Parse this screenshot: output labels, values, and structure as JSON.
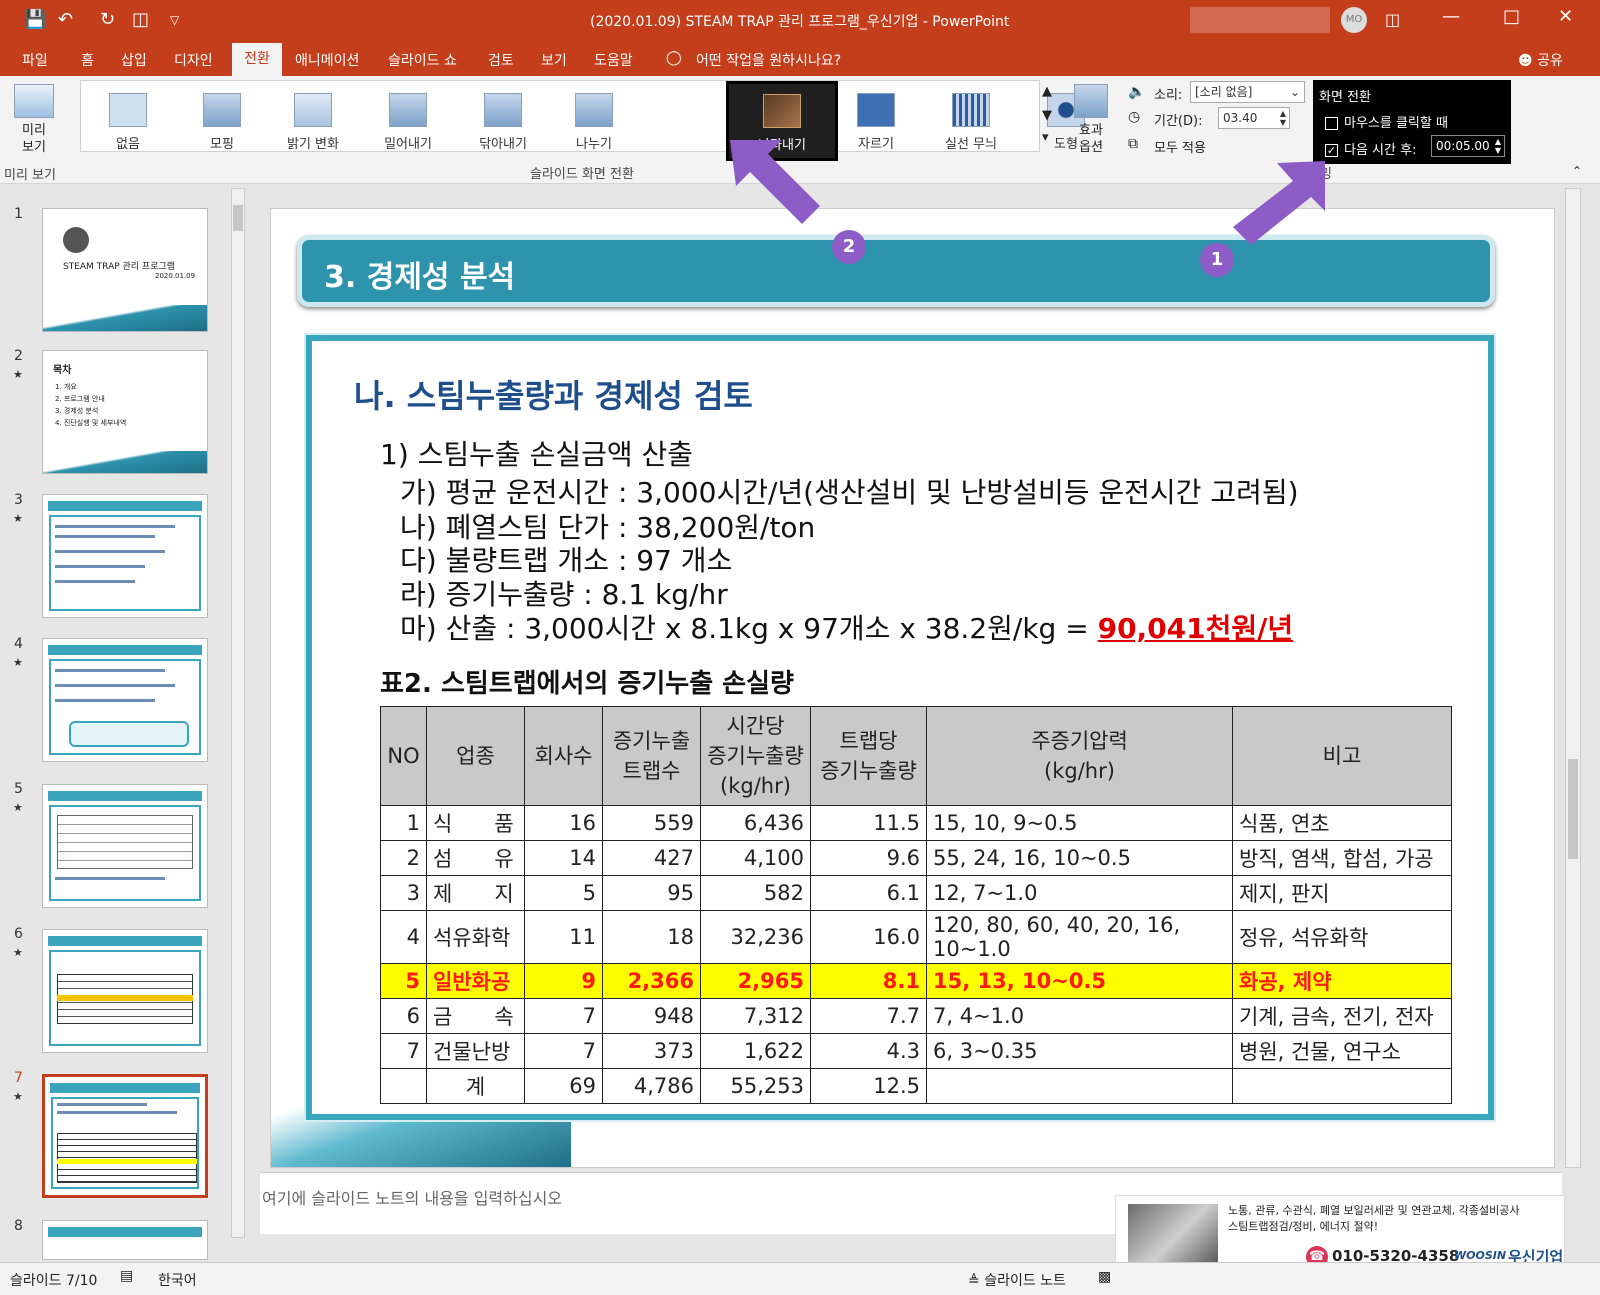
{
  "window": {
    "title": "(2020.01.09) STEAM TRAP 관리 프로그램_우신기업  -  PowerPoint",
    "avatar_initials": "MO",
    "accent": "#c43e1c"
  },
  "menu": {
    "items": [
      "파일",
      "홈",
      "삽입",
      "디자인",
      "전환",
      "애니메이션",
      "슬라이드 쇼",
      "검토",
      "보기",
      "도움말"
    ],
    "active": "전환",
    "tell_me": "어떤 작업을 원하시나요?",
    "share": "공유"
  },
  "ribbon": {
    "preview_label": "미리\n보기",
    "preview_group": "미리 보기",
    "transitions": [
      "없음",
      "모핑",
      "밝기 변화",
      "밀어내기",
      "닦아내기",
      "나누기",
      "나타내기",
      "자르기",
      "실선 무늬",
      "도형"
    ],
    "selected_transition": "나타내기",
    "effect_options": "효과\n옵션",
    "transition_group": "슬라이드 화면 전환",
    "sound_label": "소리:",
    "sound_value": "[소리 없음]",
    "duration_label": "기간(D):",
    "duration_value": "03.40",
    "apply_all": "모두 적용",
    "advance_title": "화면 전환",
    "on_click_label": "마우스를 클릭할 때",
    "on_click_checked": false,
    "after_label": "다음 시간 후:",
    "after_checked": true,
    "after_value": "00:05.00",
    "timing_group_partial": "밍"
  },
  "annotations": {
    "badge1": "1",
    "badge2": "2",
    "color": "#8e5cc7"
  },
  "thumbnails": [
    {
      "num": "1",
      "star": "",
      "title": "STEAM TRAP 관리 프로그램",
      "date": "2020.01.09"
    },
    {
      "num": "2",
      "star": "★",
      "title": "목차",
      "lines": [
        "1. 개요",
        "2. 프로그램 안내",
        "3. 경제성 분석",
        "4. 진단실행 및 세부내역"
      ]
    },
    {
      "num": "3",
      "star": "★"
    },
    {
      "num": "4",
      "star": "★"
    },
    {
      "num": "5",
      "star": "★"
    },
    {
      "num": "6",
      "star": "★"
    },
    {
      "num": "7",
      "star": "★",
      "selected": true
    },
    {
      "num": "8",
      "star": ""
    }
  ],
  "slide": {
    "header": "3. 경제성 분석",
    "subtitle": "나. 스팀누출량과 경제성 검토",
    "item1": "1) 스팀누출 손실금액 산출",
    "line_a": "가) 평균 운전시간 : 3,000시간/년(생산설비 및 난방설비등 운전시간 고려됨)",
    "line_b": "나) 폐열스팀 단가 : 38,200원/ton",
    "line_c": "다) 불량트랩 개소 : 97 개소",
    "line_d": "라) 증기누출량 : 8.1 kg/hr",
    "line_e": "마) 산출 : 3,000시간 x 8.1kg x 97개소 x 38.2원/kg = ",
    "line_e_result": "90,041천원/년",
    "table_title": "표2. 스팀트랩에서의 증기누출 손실량",
    "table": {
      "headers": [
        "NO",
        "업종",
        "회사수",
        "증기누출\n트랩수",
        "시간당\n증기누출량\n(kg/hr)",
        "트랩당\n증기누출량",
        "주증기압력\n(kg/hr)",
        "비고"
      ],
      "rows": [
        [
          "1",
          "식　　품",
          "16",
          "559",
          "6,436",
          "11.5",
          "15, 10, 9~0.5",
          "식품, 연초"
        ],
        [
          "2",
          "섬　　유",
          "14",
          "427",
          "4,100",
          "9.6",
          "55, 24, 16, 10~0.5",
          "방직, 염색, 합섬, 가공"
        ],
        [
          "3",
          "제　　지",
          "5",
          "95",
          "582",
          "6.1",
          "12, 7~1.0",
          "제지, 판지"
        ],
        [
          "4",
          "석유화학",
          "11",
          "18",
          "32,236",
          "16.0",
          "120, 80, 60, 40, 20, 16, 10~1.0",
          "정유, 석유화학"
        ],
        [
          "5",
          "일반화공",
          "9",
          "2,366",
          "2,965",
          "8.1",
          "15, 13, 10~0.5",
          "화공, 제약"
        ],
        [
          "6",
          "금　　속",
          "7",
          "948",
          "7,312",
          "7.7",
          "7, 4~1.0",
          "기계, 금속, 전기, 전자"
        ],
        [
          "7",
          "건물난방",
          "7",
          "373",
          "1,622",
          "4.3",
          "6, 3~0.35",
          "병원, 건물, 연구소"
        ],
        [
          "",
          "계",
          "69",
          "4,786",
          "55,253",
          "12.5",
          "",
          ""
        ]
      ],
      "highlight_row": 4,
      "highlight_bg": "#ffff00",
      "highlight_fg": "#ff1a1a"
    }
  },
  "notes": {
    "placeholder": "여기에 슬라이드 노트의 내용을 입력하십시오"
  },
  "ad": {
    "line1": "노통, 관류, 수관식, 폐열 보일러세관 및 연관교체, 각종설비공사",
    "line2": "스팀트랩점검/정비, 에너지 절약!",
    "phone": "010-5320-4358",
    "brand": "WOOSIN",
    "company": "우신기업"
  },
  "status": {
    "slide": "슬라이드 7/10",
    "language": "한국어",
    "notes_toggle": "슬라이드 노트"
  }
}
